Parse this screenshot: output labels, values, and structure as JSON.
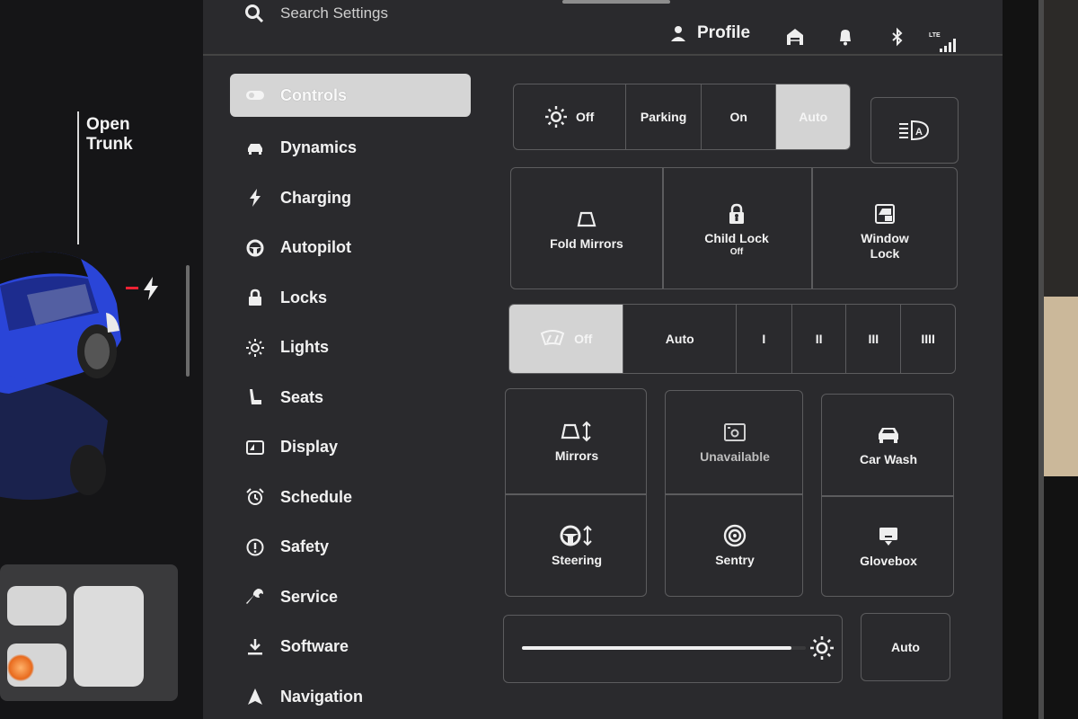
{
  "car": {
    "trunk_label": "Open\nTrunk",
    "paint_color": "#2a45d8"
  },
  "header": {
    "search_placeholder": "Search Settings",
    "profile_label": "Profile",
    "signal_label": "LTE"
  },
  "menu": [
    {
      "label": "Controls",
      "icon": "toggle-icon",
      "active": true
    },
    {
      "label": "Dynamics",
      "icon": "car-icon"
    },
    {
      "label": "Charging",
      "icon": "lightning-icon"
    },
    {
      "label": "Autopilot",
      "icon": "steering-wheel-icon"
    },
    {
      "label": "Locks",
      "icon": "lock-icon"
    },
    {
      "label": "Lights",
      "icon": "sun-icon"
    },
    {
      "label": "Seats",
      "icon": "seat-icon"
    },
    {
      "label": "Display",
      "icon": "display-icon"
    },
    {
      "label": "Schedule",
      "icon": "alarm-clock-icon"
    },
    {
      "label": "Safety",
      "icon": "exclamation-icon"
    },
    {
      "label": "Service",
      "icon": "wrench-icon"
    },
    {
      "label": "Software",
      "icon": "download-icon"
    },
    {
      "label": "Navigation",
      "icon": "navigation-arrow-icon"
    }
  ],
  "lights_mode": {
    "options": [
      "Off",
      "Parking",
      "On",
      "Auto"
    ],
    "selected": "Auto"
  },
  "toggles": {
    "fold_mirrors": "Fold Mirrors",
    "child_lock": "Child Lock",
    "child_lock_state": "Off",
    "window_lock": "Window Lock"
  },
  "wipers": {
    "options": [
      "Off",
      "Auto",
      "I",
      "II",
      "III",
      "IIII"
    ],
    "selected": "Off"
  },
  "quick_controls": {
    "mirrors": "Mirrors",
    "unavailable": "Unavailable",
    "car_wash": "Car Wash",
    "steering": "Steering",
    "sentry": "Sentry",
    "glovebox": "Glovebox"
  },
  "brightness": {
    "level": 0.95,
    "auto_label": "Auto"
  }
}
